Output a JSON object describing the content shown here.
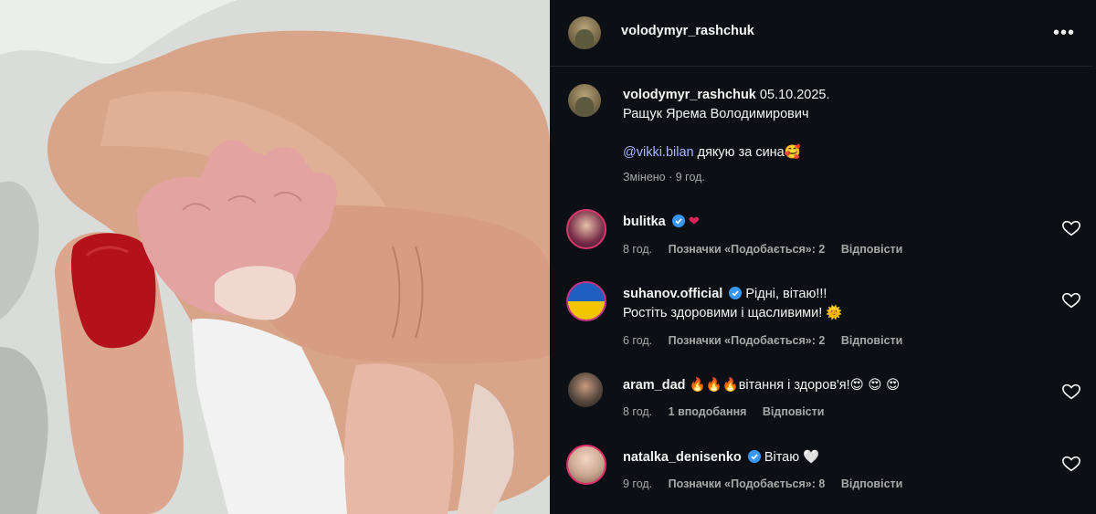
{
  "post": {
    "author": "volodymyr_rashchuk",
    "more_icon": "more-horizontal-icon"
  },
  "caption": {
    "author": "volodymyr_rashchuk",
    "date": "05.10.2025.",
    "line2": "Ращук Ярема Володимирович",
    "mention": "@vikki.bilan",
    "text": "дякую за сина",
    "emoji": "🥰",
    "edited": "Змінено",
    "time": "9 год."
  },
  "comments": [
    {
      "user": "bulitka",
      "verified": true,
      "text": "",
      "emoji": "❤",
      "emoji_color": "#e0245e",
      "time": "8 год.",
      "likes": "Позначки «Подобається»: 2",
      "reply": "Відповісти",
      "avatar_color": "#7a2d4a"
    },
    {
      "user": "suhanov.official",
      "verified": true,
      "text": "Рідні, вітаю!!!",
      "text2": "Ростіть здоровими і щасливими!",
      "emoji": "🌞",
      "time": "6 год.",
      "likes": "Позначки «Подобається»: 2",
      "reply": "Відповісти",
      "avatar_color": "#1f5fbf"
    },
    {
      "user": "aram_dad",
      "verified": false,
      "prefix_emoji": "🔥🔥🔥",
      "text": "вітання і здоров'я!",
      "emoji": "😍 😍 😍",
      "time": "8 год.",
      "likes": "1 вподобання",
      "reply": "Відповісти",
      "avatar_color": "#5a4a40"
    },
    {
      "user": "natalka_denisenko",
      "verified": true,
      "text": "Вітаю",
      "emoji": "🤍",
      "time": "9 год.",
      "likes": "Позначки «Подобається»: 8",
      "reply": "Відповісти",
      "avatar_color": "#c9a58f"
    }
  ],
  "colors": {
    "panel_bg": "#0c0f14",
    "text": "#f5f5f5",
    "muted": "#a8a8a8",
    "mention": "#a8b7ff",
    "verified": "#3897f0",
    "nail": "#b3121d"
  }
}
